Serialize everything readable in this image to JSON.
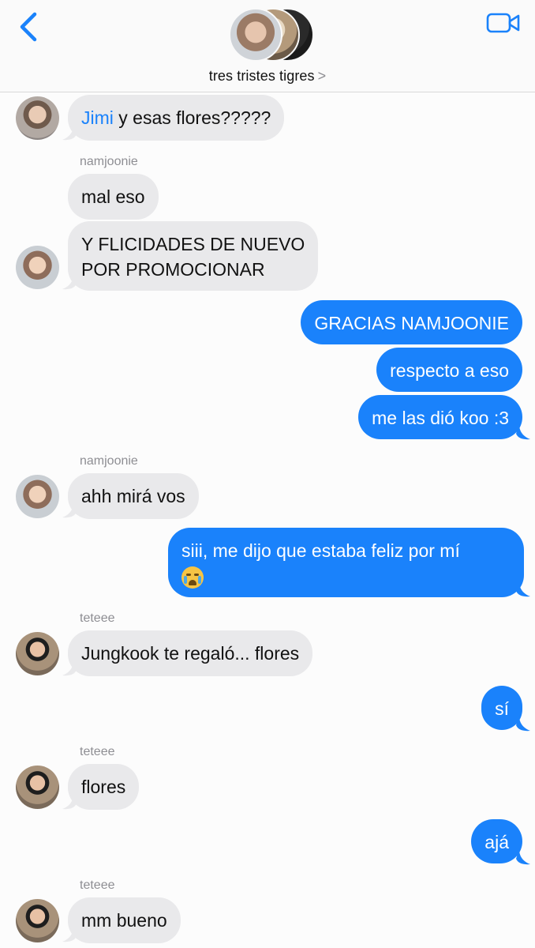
{
  "header": {
    "group_name": "tres tristes tigres",
    "chevron": ">",
    "back_icon": "chevron-left-icon",
    "video_icon": "video-camera-icon",
    "accent_color": "#1a82fb"
  },
  "messages": [
    {
      "sender": "",
      "mention": "Jimi",
      "text": " y esas flores?????"
    },
    {
      "sender": "namjoonie",
      "text": "mal eso"
    },
    {
      "sender": "",
      "text_line1": "Y FLICIDADES DE NUEVO",
      "text_line2": "POR PROMOCIONAR"
    },
    {
      "out": true,
      "text": "GRACIAS NAMJOONIE"
    },
    {
      "out": true,
      "text": "respecto a eso"
    },
    {
      "out": true,
      "text": "me las dió koo :3"
    },
    {
      "sender": "namjoonie",
      "text": "ahh mirá vos"
    },
    {
      "out": true,
      "text": "siii, me dijo que estaba feliz por mí",
      "emoji": "loudly-crying-face"
    },
    {
      "sender": "teteee",
      "text": "Jungkook te regaló... flores"
    },
    {
      "out": true,
      "text": "sí"
    },
    {
      "sender": "teteee",
      "text": "flores"
    },
    {
      "out": true,
      "text": "ajá"
    },
    {
      "sender": "teteee",
      "text": "mm bueno"
    }
  ]
}
